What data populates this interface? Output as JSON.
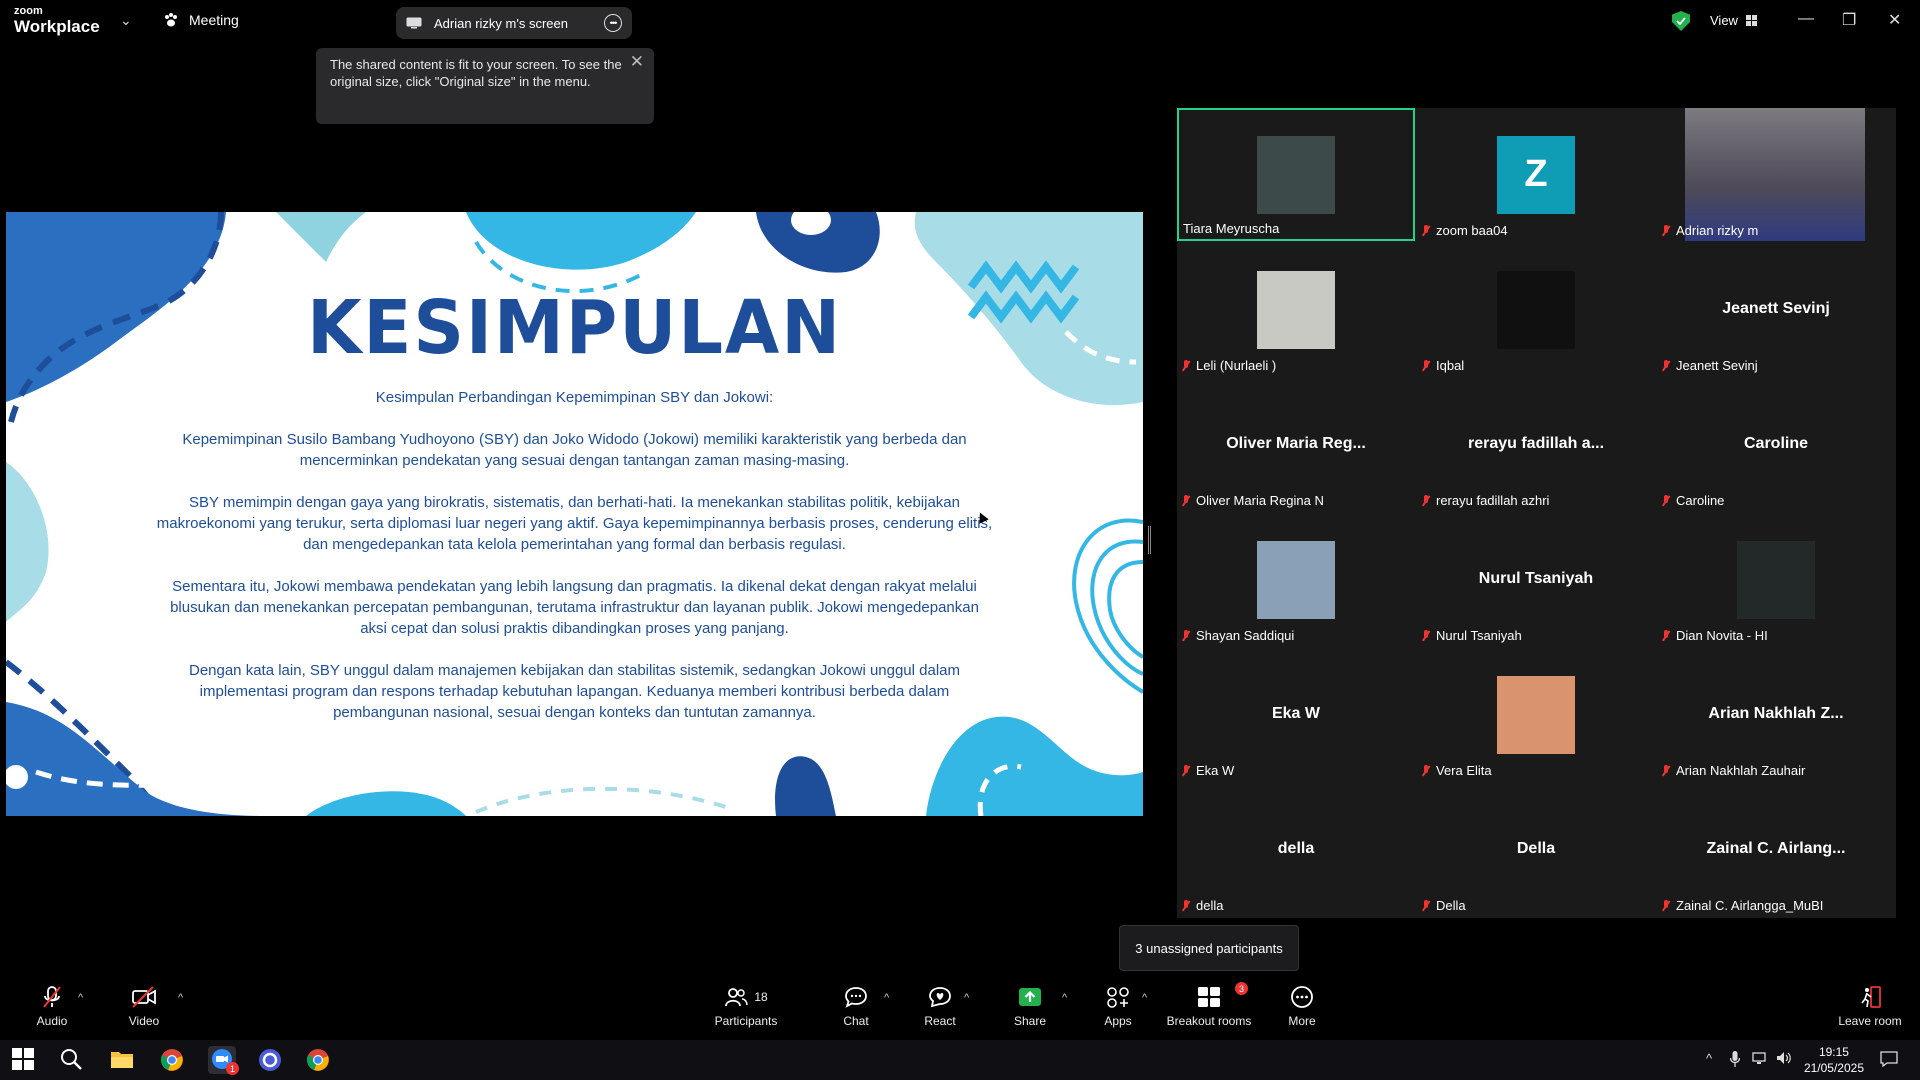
{
  "window": {
    "logo_line1": "zoom",
    "logo_line2": "Workplace",
    "meeting_label": "Meeting",
    "screen_share_label": "Adrian rizky m's screen",
    "view_label": "View"
  },
  "tooltip": {
    "text": "The shared content is fit to your screen. To see the original size, click \"Original size\" in the menu."
  },
  "slide": {
    "title": "KESIMPULAN",
    "paragraphs": [
      "Kesimpulan Perbandingan Kepemimpinan SBY dan Jokowi:",
      "Kepemimpinan Susilo Bambang Yudhoyono (SBY) dan Joko Widodo (Jokowi) memiliki karakteristik yang berbeda dan mencerminkan pendekatan yang sesuai dengan tantangan zaman masing-masing.",
      "SBY memimpin dengan gaya yang birokratis, sistematis, dan berhati-hati. Ia menekankan stabilitas politik, kebijakan makroekonomi yang terukur, serta diplomasi luar negeri yang aktif. Gaya kepemimpinannya berbasis proses, cenderung elitis, dan mengedepankan tata kelola pemerintahan yang formal dan berbasis regulasi.",
      "Sementara itu, Jokowi membawa pendekatan yang lebih langsung dan pragmatis. Ia dikenal dekat dengan rakyat melalui blusukan dan menekankan percepatan pembangunan, terutama infrastruktur dan layanan publik. Jokowi mengedepankan aksi cepat dan solusi praktis dibandingkan proses yang panjang.",
      "Dengan kata lain, SBY unggul dalam manajemen kebijakan dan stabilitas sistemik, sedangkan Jokowi unggul dalam implementasi program dan respons terhadap kebutuhan lapangan. Keduanya memberi kontribusi berbeda dalam pembangunan nasional, sesuai dengan konteks dan tuntutan zamannya."
    ]
  },
  "participants": [
    {
      "name": "Tiara Meyruscha",
      "big": "",
      "kind": "photo",
      "color": "#3d4a4a",
      "active": true,
      "muted": false
    },
    {
      "name": "zoom baa04",
      "big": "",
      "kind": "letter",
      "letter": "Z",
      "color": "#0e9db5",
      "active": false,
      "muted": true
    },
    {
      "name": "Adrian rizky m",
      "big": "",
      "kind": "video",
      "color": "#6e6a72",
      "active": false,
      "muted": true
    },
    {
      "name": "Leli (Nurlaeli )",
      "big": "",
      "kind": "photo",
      "color": "#c9c9c4",
      "active": false,
      "muted": true
    },
    {
      "name": "Iqbal",
      "big": "",
      "kind": "photo",
      "color": "#101010",
      "active": false,
      "muted": true
    },
    {
      "name": "Jeanett Sevinj",
      "big": "Jeanett Sevinj",
      "kind": "none",
      "active": false,
      "muted": true
    },
    {
      "name": "Oliver Maria Regina N",
      "big": "Oliver Maria Reg...",
      "kind": "none",
      "active": false,
      "muted": true
    },
    {
      "name": "rerayu fadillah azhri",
      "big": "rerayu fadillah a...",
      "kind": "none",
      "active": false,
      "muted": true
    },
    {
      "name": "Caroline",
      "big": "Caroline",
      "kind": "none",
      "active": false,
      "muted": true
    },
    {
      "name": "Shayan Saddiqui",
      "big": "",
      "kind": "photo",
      "color": "#8aa0b6",
      "active": false,
      "muted": true
    },
    {
      "name": "Nurul Tsaniyah",
      "big": "Nurul Tsaniyah",
      "kind": "none",
      "active": false,
      "muted": true
    },
    {
      "name": "Dian Novita - HI",
      "big": "",
      "kind": "photo",
      "color": "#232828",
      "active": false,
      "muted": true
    },
    {
      "name": "Eka W",
      "big": "Eka W",
      "kind": "none",
      "active": false,
      "muted": true
    },
    {
      "name": "Vera Elita",
      "big": "",
      "kind": "photo",
      "color": "#d9936f",
      "active": false,
      "muted": true
    },
    {
      "name": "Arian Nakhlah Zauhair",
      "big": "Arian Nakhlah Z...",
      "kind": "none",
      "active": false,
      "muted": true
    },
    {
      "name": "della",
      "big": "della",
      "kind": "none",
      "active": false,
      "muted": true
    },
    {
      "name": "Della",
      "big": "Della",
      "kind": "none",
      "active": false,
      "muted": true
    },
    {
      "name": "Zainal C. Airlangga_MuBI",
      "big": "Zainal C. Airlang...",
      "kind": "none",
      "active": false,
      "muted": true
    }
  ],
  "unassigned_label": "3 unassigned participants",
  "toolbar": {
    "audio": "Audio",
    "video": "Video",
    "participants": "Participants",
    "participants_count": "18",
    "chat": "Chat",
    "react": "React",
    "share": "Share",
    "apps": "Apps",
    "breakout": "Breakout rooms",
    "breakout_badge": "3",
    "more": "More",
    "leave": "Leave room"
  },
  "taskbar": {
    "time": "19:15",
    "date": "21/05/2025",
    "zoom_badge": "1"
  },
  "colors": {
    "slide_accent": "#1e4e9a",
    "active_border": "#23d18b",
    "share_green": "#22b14c",
    "muted_red": "#e33333"
  }
}
